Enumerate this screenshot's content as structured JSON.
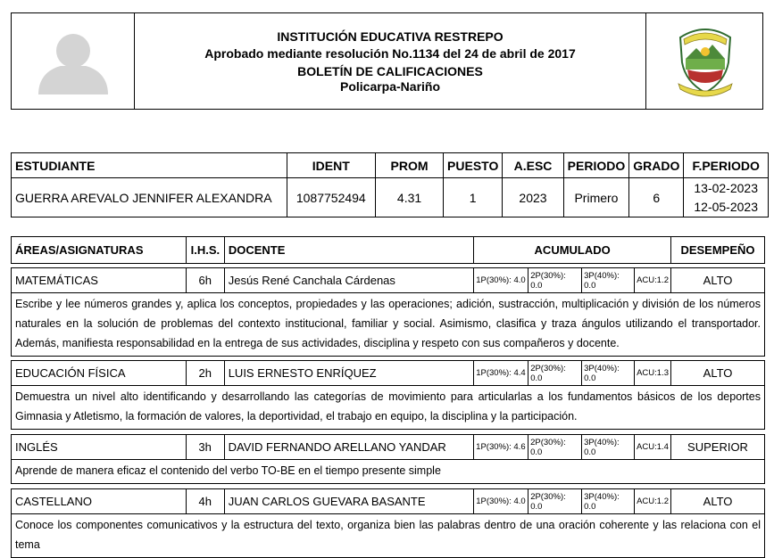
{
  "header": {
    "institution": "INSTITUCIÓN EDUCATIVA RESTREPO",
    "resolution": "Aprobado mediante resolución No.1134 del 24 de abril de 2017",
    "report_title": "BOLETÍN DE CALIFICACIONES",
    "location": "Policarpa-Nariño"
  },
  "student_table": {
    "headers": [
      "ESTUDIANTE",
      "IDENT",
      "PROM",
      "PUESTO",
      "A.ESC",
      "PERIODO",
      "GRADO",
      "F.PERIODO"
    ],
    "student": {
      "name": "GUERRA AREVALO  JENNIFER ALEXANDRA",
      "ident": "1087752494",
      "prom": "4.31",
      "puesto": "1",
      "a_esc": "2023",
      "periodo": "Primero",
      "grado": "6",
      "f_periodo_start": "13-02-2023",
      "f_periodo_end": "12-05-2023"
    }
  },
  "subjects_header": {
    "area": "ÁREAS/ASIGNATURAS",
    "ihs": "I.H.S.",
    "docente": "DOCENTE",
    "acumulado": "ACUMULADO",
    "desempeno": "DESEMPEÑO"
  },
  "subjects": [
    {
      "name": "MATEMÁTICAS",
      "ihs": "6h",
      "teacher": "Jesús René Canchala Cárdenas",
      "p1": "1P(30%): 4.0",
      "p2": "2P(30%): 0.0",
      "p3": "3P(40%): 0.0",
      "acu": "ACU:1.2",
      "performance": "ALTO",
      "description": "Escribe y lee números grandes y, aplica los conceptos, propiedades y las operaciones; adición, sustracción, multiplicación y división de los números naturales en la solución de problemas del contexto institucional, familiar y social. Asimismo, clasifica y traza ángulos utilizando el transportador. Además, manifiesta responsabilidad en la entrega de sus actividades, disciplina y respeto con sus compañeros y docente."
    },
    {
      "name": "EDUCACIÓN FÍSICA",
      "ihs": "2h",
      "teacher": "LUIS ERNESTO ENRÍQUEZ",
      "p1": "1P(30%): 4.4",
      "p2": "2P(30%): 0.0",
      "p3": "3P(40%): 0.0",
      "acu": "ACU:1.3",
      "performance": "ALTO",
      "description": "Demuestra un nivel alto identificando y desarrollando las categorías de movimiento para articularlas a los fundamentos básicos de los deportes Gimnasia y Atletismo, la formación de valores, la deportividad, el trabajo en equipo, la disciplina y la participación."
    },
    {
      "name": "INGLÉS",
      "ihs": "3h",
      "teacher": "DAVID FERNANDO ARELLANO YANDAR",
      "p1": "1P(30%): 4.6",
      "p2": "2P(30%): 0.0",
      "p3": "3P(40%): 0.0",
      "acu": "ACU:1.4",
      "performance": "SUPERIOR",
      "description": "Aprende de manera eficaz el contenido del verbo TO-BE en el tiempo presente simple"
    },
    {
      "name": "CASTELLANO",
      "ihs": "4h",
      "teacher": "JUAN CARLOS GUEVARA BASANTE",
      "p1": "1P(30%): 4.0",
      "p2": "2P(30%): 0.0",
      "p3": "3P(40%): 0.0",
      "acu": "ACU:1.2",
      "performance": "ALTO",
      "description": "Conoce los componentes comunicativos y la estructura del texto, organiza bien las palabras dentro de una oración coherente y las relaciona con el tema"
    }
  ]
}
